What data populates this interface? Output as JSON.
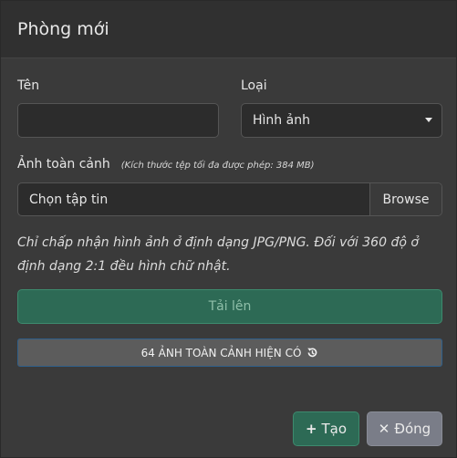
{
  "modal": {
    "title": "Phòng mới",
    "name_label": "Tên",
    "name_value": "",
    "type_label": "Loại",
    "type_selected": "Hình ảnh",
    "panorama_label": "Ảnh toàn cảnh",
    "panorama_hint": "(Kích thước tệp tối đa được phép: 384 MB)",
    "file_placeholder": "Chọn tập tin",
    "browse_label": "Browse",
    "note": "Chỉ chấp nhận hình ảnh ở định dạng JPG/PNG. Đối với 360 độ ở định dạng 2:1 đều hình chữ nhật.",
    "upload_label": "Tải lên",
    "existing_label": "64 ẢNH TOÀN CẢNH HIỆN CÓ",
    "create_label": "Tạo",
    "close_label": "Đóng"
  },
  "icons": {
    "existing": "history-icon",
    "create": "plus-icon",
    "close": "close-icon",
    "select": "chevron-down-icon"
  }
}
